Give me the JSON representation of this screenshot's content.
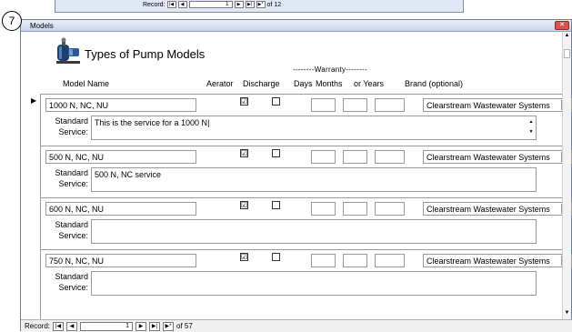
{
  "background_window": {
    "nav_label": "Record:",
    "current": "1",
    "of_label": "of 12"
  },
  "callout_number": "7",
  "window": {
    "title": "Models",
    "close_glyph": "✕"
  },
  "form": {
    "title": "Types of Pump Models",
    "warranty_header": "--------Warranty--------",
    "columns": {
      "model_name": "Model Name",
      "aerator": "Aerator",
      "discharge": "Discharge",
      "days": "Days",
      "months": "Months",
      "years": "or Years",
      "brand": "Brand (optional)"
    },
    "standard_label": "Standard",
    "service_label": "Service:"
  },
  "records": [
    {
      "model": "1000 N, NC, NU",
      "aerator": true,
      "discharge": false,
      "days": "",
      "months": "",
      "years": "",
      "brand": "Clearstream Wastewater Systems",
      "service": "This is the service for a 1000 N",
      "current": true
    },
    {
      "model": "500 N, NC, NU",
      "aerator": true,
      "discharge": false,
      "days": "",
      "months": "",
      "years": "",
      "brand": "Clearstream Wastewater Systems",
      "service": "500 N, NC service",
      "current": false
    },
    {
      "model": "600 N, NC, NU",
      "aerator": true,
      "discharge": false,
      "days": "",
      "months": "",
      "years": "",
      "brand": "Clearstream Wastewater Systems",
      "service": "",
      "current": false
    },
    {
      "model": "750 N, NC, NU",
      "aerator": true,
      "discharge": false,
      "days": "",
      "months": "",
      "years": "",
      "brand": "Clearstream Wastewater Systems",
      "service": "",
      "current": false
    }
  ],
  "navigation": {
    "label": "Record:",
    "current": "1",
    "of_label": "of 57"
  },
  "icons": {
    "form_icon": "pump-icon",
    "checkbox_checked": "☑"
  },
  "colors": {
    "titlebar": "#c7d5ea",
    "close": "#d9534f"
  }
}
